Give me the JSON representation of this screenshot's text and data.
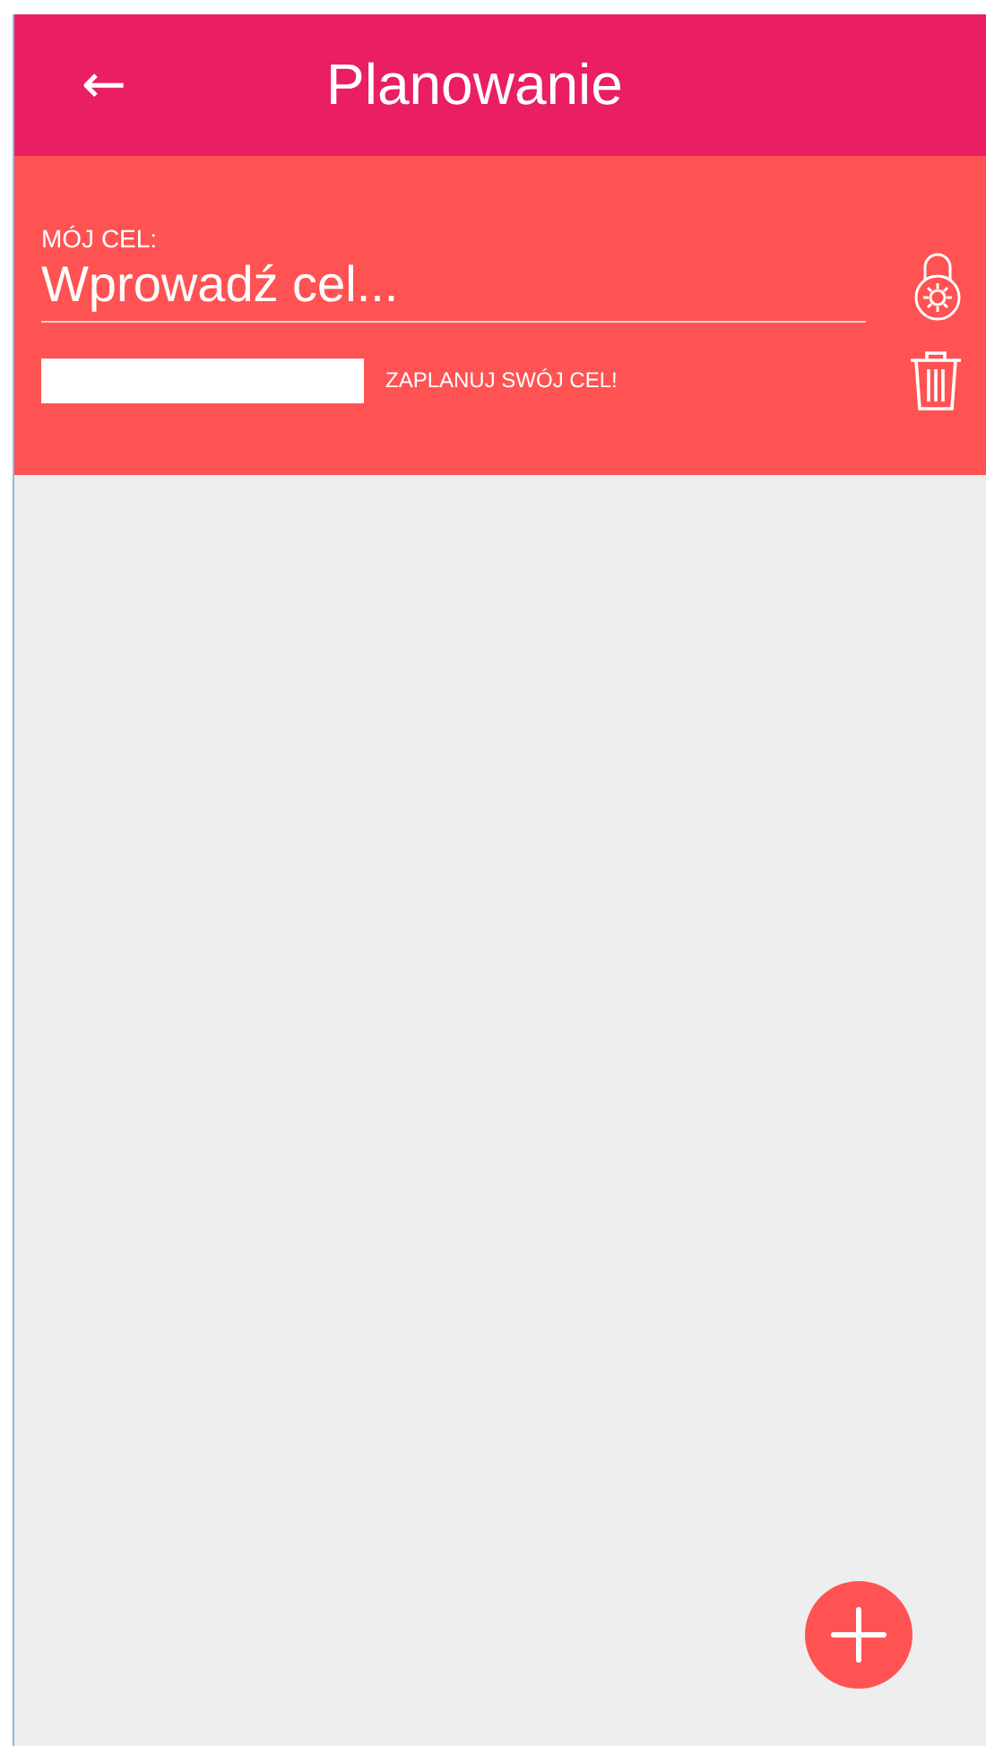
{
  "app_bar": {
    "back": "←",
    "title": "Planowanie"
  },
  "goal": {
    "label": "MÓJ CEL:",
    "placeholder": "Wprowadź cel...",
    "hint": "ZAPLANUJ SWÓJ CEL!"
  }
}
